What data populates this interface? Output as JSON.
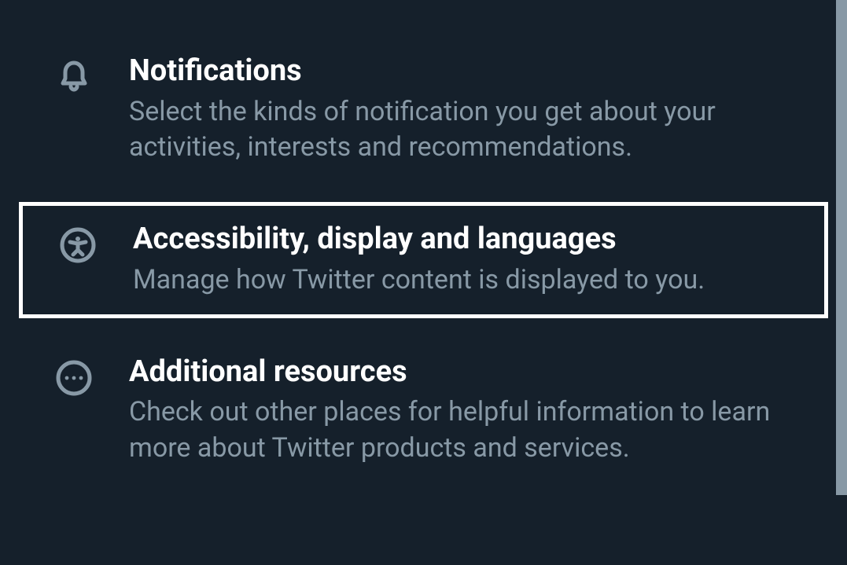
{
  "settings": {
    "items": [
      {
        "title": "Notifications",
        "description": "Select the kinds of notification you get about your activities, interests and recommendations."
      },
      {
        "title": "Accessibility, display and languages",
        "description": "Manage how Twitter content is displayed to you."
      },
      {
        "title": "Additional resources",
        "description": "Check out other places for helpful information to learn more about Twitter products and services."
      }
    ]
  }
}
